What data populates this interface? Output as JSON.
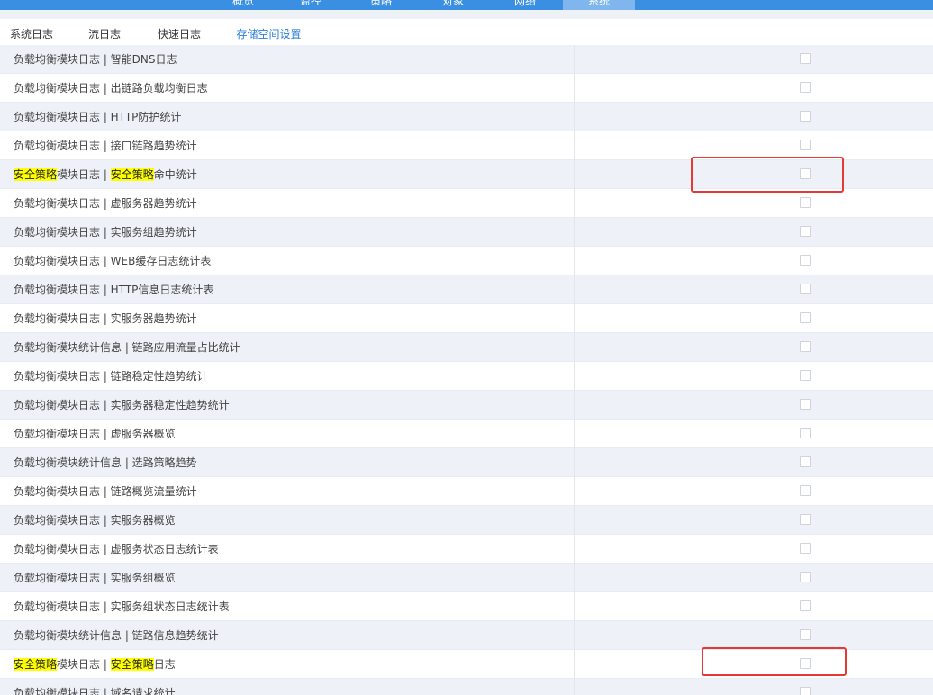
{
  "top_nav": {
    "items": [
      {
        "label": "概览"
      },
      {
        "label": "监控"
      },
      {
        "label": "策略"
      },
      {
        "label": "对象"
      },
      {
        "label": "网络"
      },
      {
        "label": "系统"
      }
    ],
    "active_index": 5
  },
  "tabs": [
    {
      "label": "系统日志",
      "active": false
    },
    {
      "label": "流日志",
      "active": false
    },
    {
      "label": "快速日志",
      "active": false
    },
    {
      "label": "存储空间设置",
      "active": true
    }
  ],
  "rows": [
    {
      "parts": [
        {
          "text": "负载均衡模块日志 | 智能DNS日志",
          "hl": false
        }
      ],
      "checked": false
    },
    {
      "parts": [
        {
          "text": "负载均衡模块日志 | 出链路负载均衡日志",
          "hl": false
        }
      ],
      "checked": false
    },
    {
      "parts": [
        {
          "text": "负载均衡模块日志 | HTTP防护统计",
          "hl": false
        }
      ],
      "checked": false
    },
    {
      "parts": [
        {
          "text": "负载均衡模块日志 | 接口链路趋势统计",
          "hl": false
        }
      ],
      "checked": false
    },
    {
      "parts": [
        {
          "text": "安全策略",
          "hl": true
        },
        {
          "text": "模块日志 | ",
          "hl": false
        },
        {
          "text": "安全策略",
          "hl": true
        },
        {
          "text": "命中统计",
          "hl": false
        }
      ],
      "checked": false,
      "highlighted_box": true
    },
    {
      "parts": [
        {
          "text": "负载均衡模块日志 | 虚服务器趋势统计",
          "hl": false
        }
      ],
      "checked": false
    },
    {
      "parts": [
        {
          "text": "负载均衡模块日志 | 实服务组趋势统计",
          "hl": false
        }
      ],
      "checked": false
    },
    {
      "parts": [
        {
          "text": "负载均衡模块日志 | WEB缓存日志统计表",
          "hl": false
        }
      ],
      "checked": false
    },
    {
      "parts": [
        {
          "text": "负载均衡模块日志 | HTTP信息日志统计表",
          "hl": false
        }
      ],
      "checked": false
    },
    {
      "parts": [
        {
          "text": "负载均衡模块日志 | 实服务器趋势统计",
          "hl": false
        }
      ],
      "checked": false
    },
    {
      "parts": [
        {
          "text": "负载均衡模块统计信息 | 链路应用流量占比统计",
          "hl": false
        }
      ],
      "checked": false
    },
    {
      "parts": [
        {
          "text": "负载均衡模块日志 | 链路稳定性趋势统计",
          "hl": false
        }
      ],
      "checked": false
    },
    {
      "parts": [
        {
          "text": "负载均衡模块日志 | 实服务器稳定性趋势统计",
          "hl": false
        }
      ],
      "checked": false
    },
    {
      "parts": [
        {
          "text": "负载均衡模块日志 | 虚服务器概览",
          "hl": false
        }
      ],
      "checked": false
    },
    {
      "parts": [
        {
          "text": "负载均衡模块统计信息 | 选路策略趋势",
          "hl": false
        }
      ],
      "checked": false
    },
    {
      "parts": [
        {
          "text": "负载均衡模块日志 | 链路概览流量统计",
          "hl": false
        }
      ],
      "checked": false
    },
    {
      "parts": [
        {
          "text": "负载均衡模块日志 | 实服务器概览",
          "hl": false
        }
      ],
      "checked": false
    },
    {
      "parts": [
        {
          "text": "负载均衡模块日志 | 虚服务状态日志统计表",
          "hl": false
        }
      ],
      "checked": false
    },
    {
      "parts": [
        {
          "text": "负载均衡模块日志 | 实服务组概览",
          "hl": false
        }
      ],
      "checked": false
    },
    {
      "parts": [
        {
          "text": "负载均衡模块日志 | 实服务组状态日志统计表",
          "hl": false
        }
      ],
      "checked": false
    },
    {
      "parts": [
        {
          "text": "负载均衡模块统计信息 | 链路信息趋势统计",
          "hl": false
        }
      ],
      "checked": false
    },
    {
      "parts": [
        {
          "text": "安全策略",
          "hl": true
        },
        {
          "text": "模块日志 | ",
          "hl": false
        },
        {
          "text": "安全策略",
          "hl": true
        },
        {
          "text": "日志",
          "hl": false
        }
      ],
      "checked": false,
      "highlighted_box": true
    },
    {
      "parts": [
        {
          "text": "负载均衡模块日志 | 域名请求统计",
          "hl": false
        }
      ],
      "checked": false
    }
  ],
  "colors": {
    "nav_bg": "#3b8fe2",
    "tab_active": "#2a7ed8",
    "row_alt": "#eef2f8",
    "highlight": "#ffff00",
    "annotation_box": "#e53935"
  }
}
